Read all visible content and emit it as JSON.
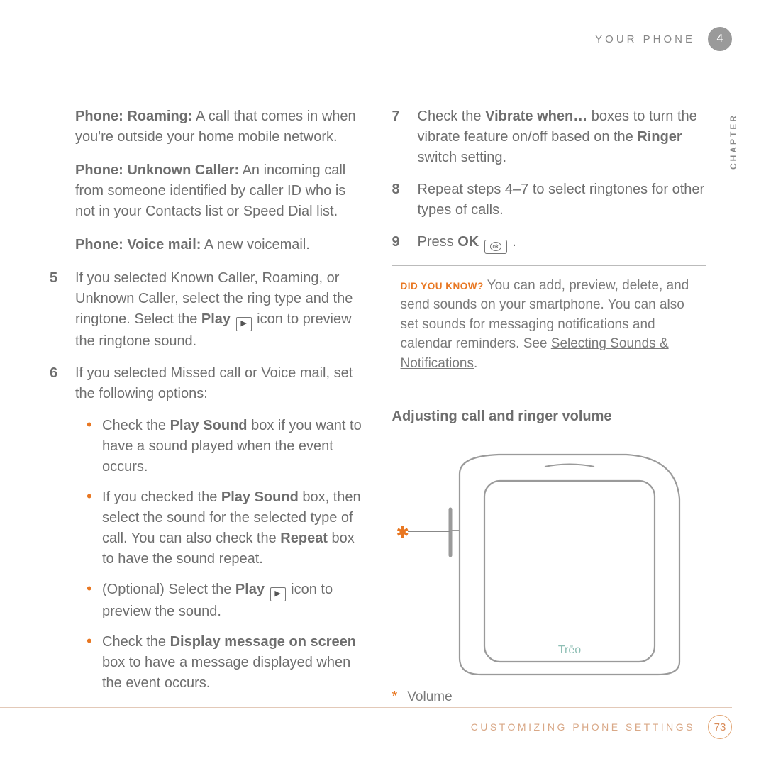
{
  "header": {
    "section": "YOUR PHONE",
    "chapter_num": "4",
    "chapter_label": "CHAPTER"
  },
  "left": {
    "roaming": {
      "label": "Phone: Roaming:",
      "text": " A call that comes in when you're outside your home mobile network."
    },
    "unknown": {
      "label": "Phone: Unknown Caller:",
      "text": " An incoming call from someone identified by caller ID who is not in your Contacts list or Speed Dial list."
    },
    "voicemail": {
      "label": "Phone: Voice mail:",
      "text": " A new voicemail."
    },
    "step5": {
      "num": "5",
      "pre": "If you selected Known Caller, Roaming, or Unknown Caller, select the ring type and the ringtone. Select the ",
      "play": "Play",
      "post": " icon to preview the ringtone sound."
    },
    "step6": {
      "num": "6",
      "text": "If you selected Missed call or Voice mail, set the following options:"
    },
    "b1": {
      "pre": "Check the ",
      "bold": "Play Sound",
      "post": " box if you want to have a sound played when the event occurs."
    },
    "b2": {
      "pre": "If you checked the ",
      "bold1": "Play Sound",
      "mid": " box, then select the sound for the selected type of call. You can also check the ",
      "bold2": "Repeat",
      "post": " box to have the sound repeat."
    },
    "b3": {
      "pre": "(Optional) Select the ",
      "bold": "Play",
      "post": " icon to preview the sound."
    },
    "b4": {
      "pre": "Check the ",
      "bold": "Display message on screen",
      "post": " box to have a message displayed when the event occurs."
    }
  },
  "right": {
    "step7": {
      "num": "7",
      "pre": "Check the ",
      "bold1": "Vibrate when…",
      "mid": " boxes to turn the vibrate feature on/off based on the ",
      "bold2": "Ringer",
      "post": " switch setting."
    },
    "step8": {
      "num": "8",
      "text": "Repeat steps 4–7 to select ringtones for other types of calls."
    },
    "step9": {
      "num": "9",
      "pre": "Press ",
      "bold": "OK",
      "post": " ."
    },
    "tip": {
      "label": "DID YOU KNOW?",
      "text": " You can add, preview, delete, and send sounds on your smartphone. You can also set sounds for messaging notifications and calendar reminders. See ",
      "link": "Selecting Sounds & Notifications",
      "post": "."
    },
    "heading": "Adjusting call and ringer volume",
    "legend_star": "*",
    "legend_text": "Volume",
    "device_label": "Trēo"
  },
  "footer": {
    "text": "CUSTOMIZING PHONE SETTINGS",
    "page": "73"
  }
}
